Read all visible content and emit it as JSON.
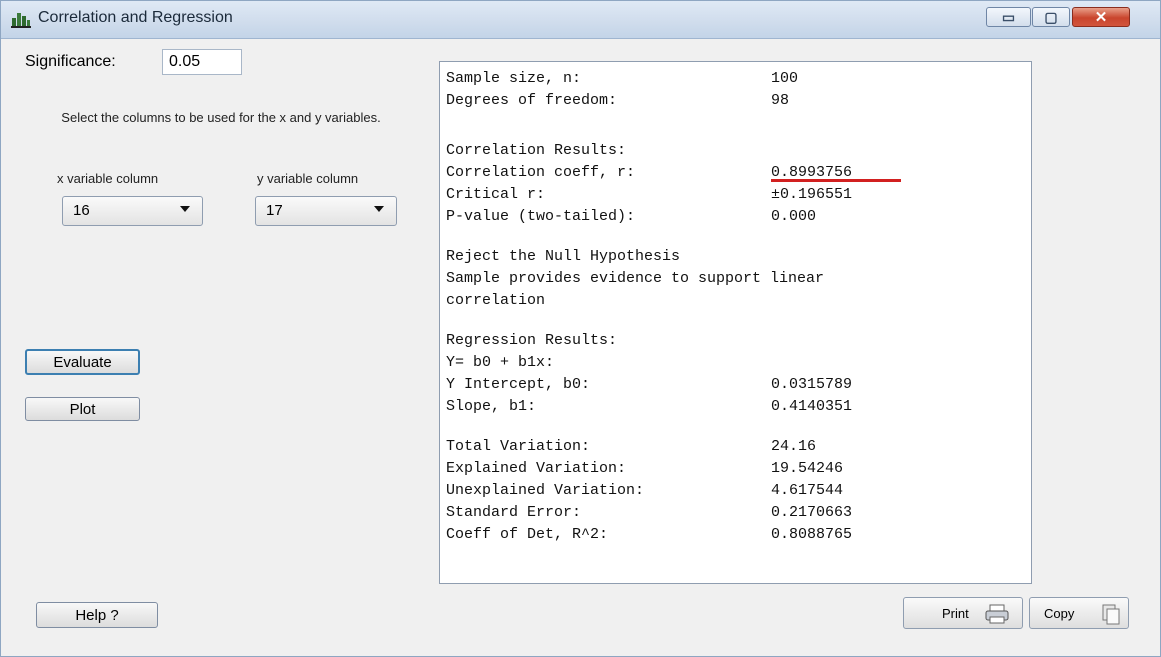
{
  "window": {
    "title": "Correlation and Regression",
    "controls": {
      "minimize": "▭",
      "maximize": "▢",
      "close": "✕"
    }
  },
  "significance": {
    "label": "Significance:",
    "value": "0.05"
  },
  "instructions": "Select the columns to be used for the x and y variables.",
  "x_column": {
    "label": "x variable column",
    "value": "16"
  },
  "y_column": {
    "label": "y variable column",
    "value": "17"
  },
  "buttons": {
    "evaluate": "Evaluate",
    "plot": "Plot",
    "help": "Help ?",
    "print": "Print",
    "copy": "Copy"
  },
  "results": {
    "lines": [
      {
        "label": "Sample size, n:",
        "value": "100"
      },
      {
        "label": "Degrees of freedom:",
        "value": "98"
      },
      {
        "label": "",
        "value": ""
      },
      {
        "label": "Correlation Results:",
        "value": ""
      },
      {
        "label": "Correlation coeff, r:",
        "value": "0.8993756"
      },
      {
        "label": "Critical r:",
        "value": "±0.196551"
      },
      {
        "label": "P-value (two-tailed):",
        "value": "0.000"
      },
      {
        "label": "",
        "value": ""
      },
      {
        "label": "Reject the Null Hypothesis",
        "value": ""
      },
      {
        "label": "Sample provides evidence to support linear",
        "value": ""
      },
      {
        "label": "correlation",
        "value": ""
      },
      {
        "label": "",
        "value": ""
      },
      {
        "label": "Regression Results:",
        "value": ""
      },
      {
        "label": "Y= b0 + b1x:",
        "value": ""
      },
      {
        "label": "Y Intercept, b0:",
        "value": "0.0315789"
      },
      {
        "label": "Slope, b1:",
        "value": "0.4140351"
      },
      {
        "label": "",
        "value": ""
      },
      {
        "label": "Total Variation:",
        "value": "24.16"
      },
      {
        "label": "Explained Variation:",
        "value": "19.54246"
      },
      {
        "label": "Unexplained Variation:",
        "value": "4.617544"
      },
      {
        "label": "Standard Error:",
        "value": "0.2170663"
      },
      {
        "label": "Coeff of Det, R^2:",
        "value": "0.8088765"
      }
    ],
    "highlight_color": "#d22020"
  }
}
